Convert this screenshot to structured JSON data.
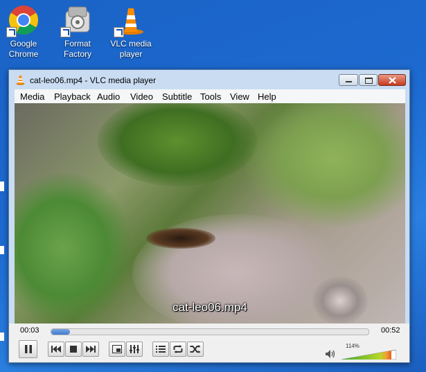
{
  "desktop": {
    "icons": [
      {
        "label_line1": "Google",
        "label_line2": "Chrome",
        "icon": "chrome-icon"
      },
      {
        "label_line1": "Format",
        "label_line2": "Factory",
        "icon": "format-factory-icon"
      },
      {
        "label_line1": "VLC media",
        "label_line2": "player",
        "icon": "vlc-cone-icon"
      }
    ]
  },
  "window": {
    "title": "cat-leo06.mp4 - VLC media player",
    "menu": [
      "Media",
      "Playback",
      "Audio",
      "Video",
      "Subtitle",
      "Tools",
      "View",
      "Help"
    ],
    "video_caption": "cat-leo06.mp4",
    "elapsed": "00:03",
    "duration": "00:52",
    "progress_fraction": 0.06,
    "volume_label": "114%",
    "volume_fraction": 0.91
  },
  "colors": {
    "desktop_bg": "#1d6ad0",
    "progress_blue": "#3f7bd0",
    "volume_green": "#3caa2a",
    "volume_orange": "#f0a030"
  }
}
